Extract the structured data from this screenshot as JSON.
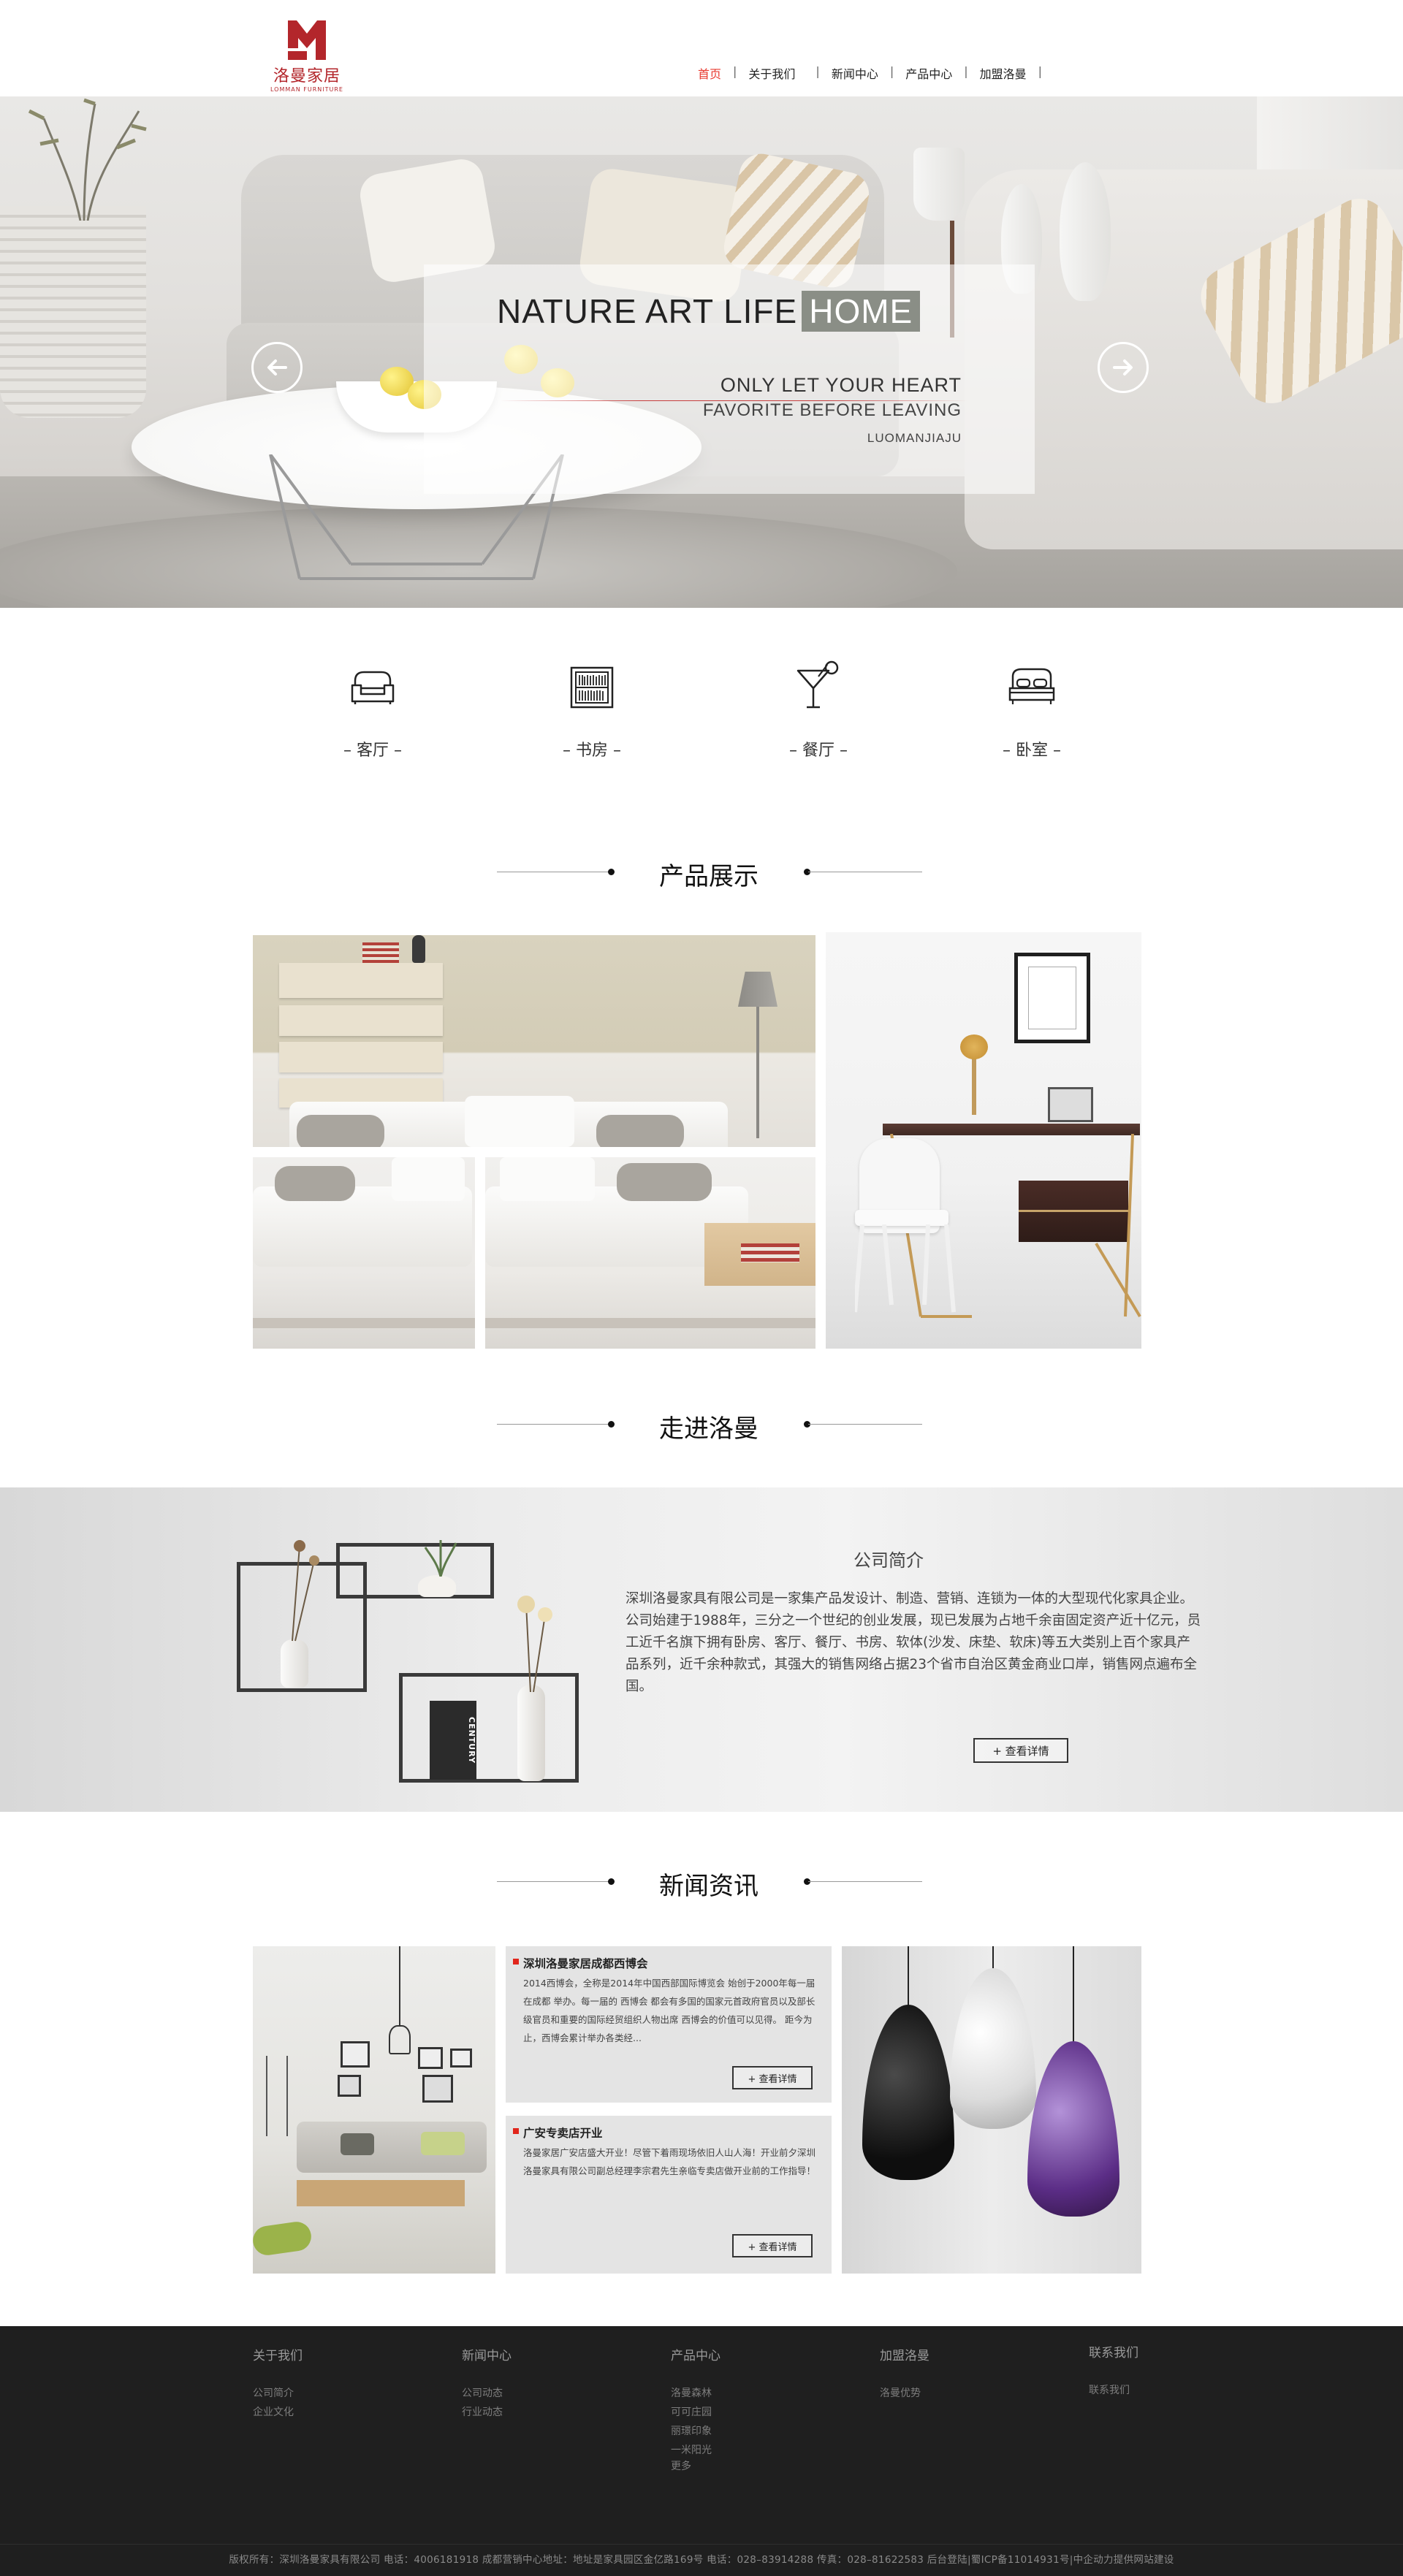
{
  "header": {
    "logo_text": "洛曼家居",
    "logo_sub": "LOMMAN FURNITURE",
    "nav": [
      "首页",
      "关于我们",
      "新闻中心",
      "产品中心",
      "加盟洛曼"
    ],
    "active_nav": "首页",
    "accent_color": "#e8382d"
  },
  "banner": {
    "title": "NATURE ART LIFE",
    "title_highlight": "HOME",
    "line1": "ONLY LET YOUR HEART",
    "line2": "FAVORITE BEFORE LEAVING",
    "line3": "LUOMANJIAJU",
    "prev_icon": "arrow-left-icon",
    "next_icon": "arrow-right-icon"
  },
  "categories": [
    {
      "label": "– 客厅 –",
      "icon": "armchair-icon"
    },
    {
      "label": "– 书房 –",
      "icon": "bookshelf-icon"
    },
    {
      "label": "– 餐厅 –",
      "icon": "cocktail-icon"
    },
    {
      "label": "– 卧室 –",
      "icon": "bed-icon"
    }
  ],
  "sections": {
    "products": "产品展示",
    "about": "走进洛曼",
    "news": "新闻资讯"
  },
  "about": {
    "title": "公司简介",
    "text": "深圳洛曼家具有限公司是一家集产品发设计、制造、营销、连锁为一体的大型现代化家具企业。公司始建于1988年，三分之一个世纪的创业发展，现已发展为占地千余亩固定资产近十亿元，员工近千名旗下拥有卧房、客厅、餐厅、书房、软体(沙发、床垫、软床)等五大类别上百个家具产品系列，近千余种款式，其强大的销售网络占据23个省市自治区黄金商业口岸，销售网点遍布全国。",
    "more": "+ 查看详情",
    "book_text": "CENTURY"
  },
  "news": [
    {
      "title": "深圳洛曼家居成都西博会",
      "body": "2014西博会，全称是2014年中国西部国际博览会 始创于2000年每一届在成都 举办。每一届的 西博会 都会有多国的国家元首政府官员以及部长级官员和重要的国际经贸组织人物出席 西博会的价值可以见得。 距今为止，西博会累计举办各类经...",
      "more": "+ 查看详情"
    },
    {
      "title": "广安专卖店开业",
      "body": "洛曼家居广安店盛大开业！尽管下着雨现场依旧人山人海！开业前夕深圳洛曼家具有限公司副总经理李宗君先生亲临专卖店做开业前的工作指导！",
      "more": "+ 查看详情"
    }
  ],
  "footer": {
    "columns": [
      {
        "title": "关于我们",
        "links": [
          "公司简介",
          "企业文化"
        ]
      },
      {
        "title": "新闻中心",
        "links": [
          "公司动态",
          "行业动态"
        ]
      },
      {
        "title": "产品中心",
        "links": [
          "洛曼森林",
          "可可庄园",
          "丽璟印象",
          "一米阳光",
          "更多"
        ]
      },
      {
        "title": "加盟洛曼",
        "links": [
          "洛曼优势"
        ]
      },
      {
        "title": "联系我们",
        "links": [
          "联系我们"
        ]
      }
    ],
    "copyright": "版权所有：深圳洛曼家具有限公司 电话：4006181918 成都营销中心地址：地址是家具园区金亿路169号 电话：028–83914288 传真：028–81622583 后台登陆|蜀ICP备11014931号|中企动力提供网站建设"
  }
}
